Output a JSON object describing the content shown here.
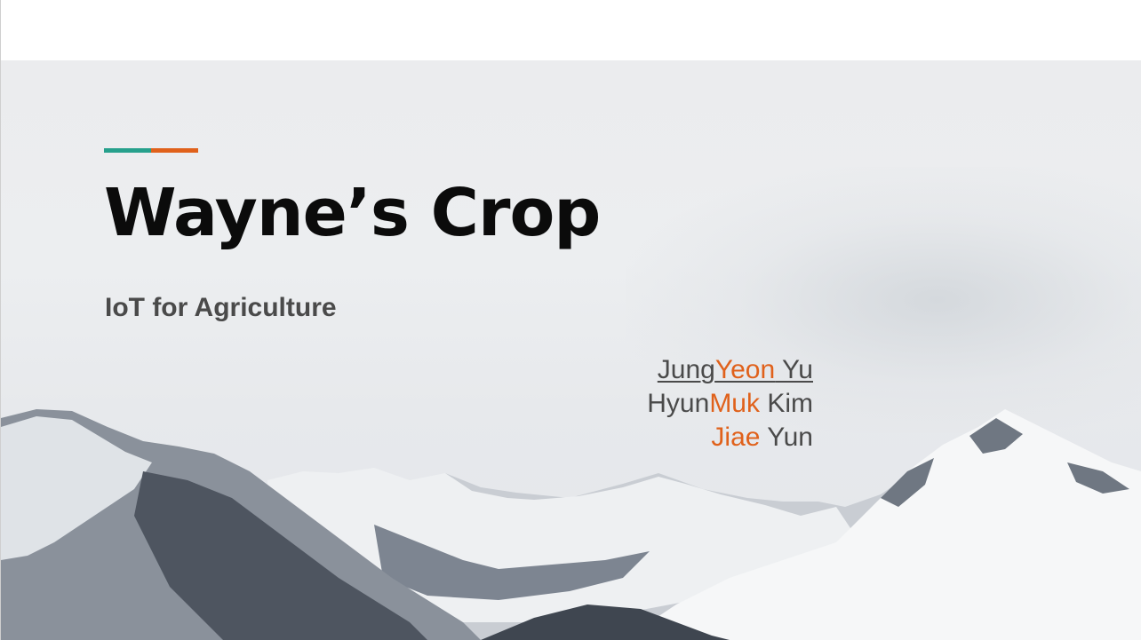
{
  "colors": {
    "accent_teal": "#26a08c",
    "accent_orange": "#e0611b",
    "title_text": "#0b0b0b",
    "body_text": "#4a4a4a"
  },
  "slide": {
    "title": "Wayne’s Crop",
    "subtitle": "IoT for Agriculture",
    "background_icon": "snowy-mountains-photo"
  },
  "authors": [
    {
      "part1": "Jung",
      "highlight": "Yeon",
      "part2": " Yu",
      "linked": true
    },
    {
      "part1": "Hyun",
      "highlight": "Muk",
      "part2": " Kim",
      "linked": false
    },
    {
      "part1": "",
      "highlight": "Jiae",
      "part2": " Yun",
      "linked": false
    }
  ]
}
